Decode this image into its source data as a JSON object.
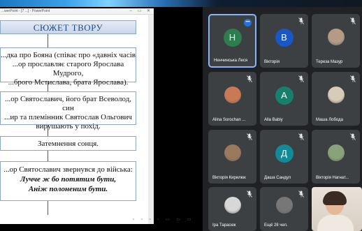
{
  "window": {
    "titlebar_text": "...werPoint - [7 ...] - PowerPoint",
    "controls": "–  ▭  ✕"
  },
  "slide": {
    "title": "СЮЖЕТ ТВОРУ",
    "box1_lines": [
      "...дка про Бояна (співає про «давніх часів",
      "...ор прославляє старого Ярослава Мудрого,",
      "...брого Мстислава, брата Ярослава)."
    ],
    "box2_lines": [
      "...ор Святославич, його брат Всеволод, син",
      "...ир та племінник Святослав Ольгович",
      "вирушають у похід."
    ],
    "box3_text": "Затемнення сонця.",
    "box4_line1": "...ор Святославич звернувся до війська:",
    "box4_quote1": "Лучче ж бо потятим бути,",
    "box4_quote2": "Аніж полоненим бути."
  },
  "participants": [
    {
      "name": "Ненчинська Леся",
      "initial": "Н",
      "color": "#2e7d4f",
      "speaking": true
    },
    {
      "name": "Вікторія",
      "initial": "В",
      "color": "#1a56c4",
      "speaking": false
    },
    {
      "name": "Тереза Мазур",
      "photo": true,
      "color": "#b59a86"
    },
    {
      "name": "Alina Sorochan ...",
      "photo": true,
      "color": "#c97a55"
    },
    {
      "name": "Alla Babiy",
      "initial": "A",
      "color": "#17806d"
    },
    {
      "name": "Маша Лобода",
      "photo": true,
      "color": "#d8cbb8"
    },
    {
      "name": "Вікторія Кирилюк",
      "photo": true,
      "color": "#9a7a5e"
    },
    {
      "name": "Даша Сандул",
      "initial": "Д",
      "color": "#138a97"
    },
    {
      "name": "Вікторія Нагнат...",
      "photo": true,
      "color": "#8aa27a"
    },
    {
      "name": "Іра Тарасюк",
      "photo": true,
      "color": "#d7d7d7"
    },
    {
      "name": "Ещё 28 чел.",
      "photo": true,
      "color": "#777777"
    },
    {
      "name": "",
      "video": true
    }
  ]
}
